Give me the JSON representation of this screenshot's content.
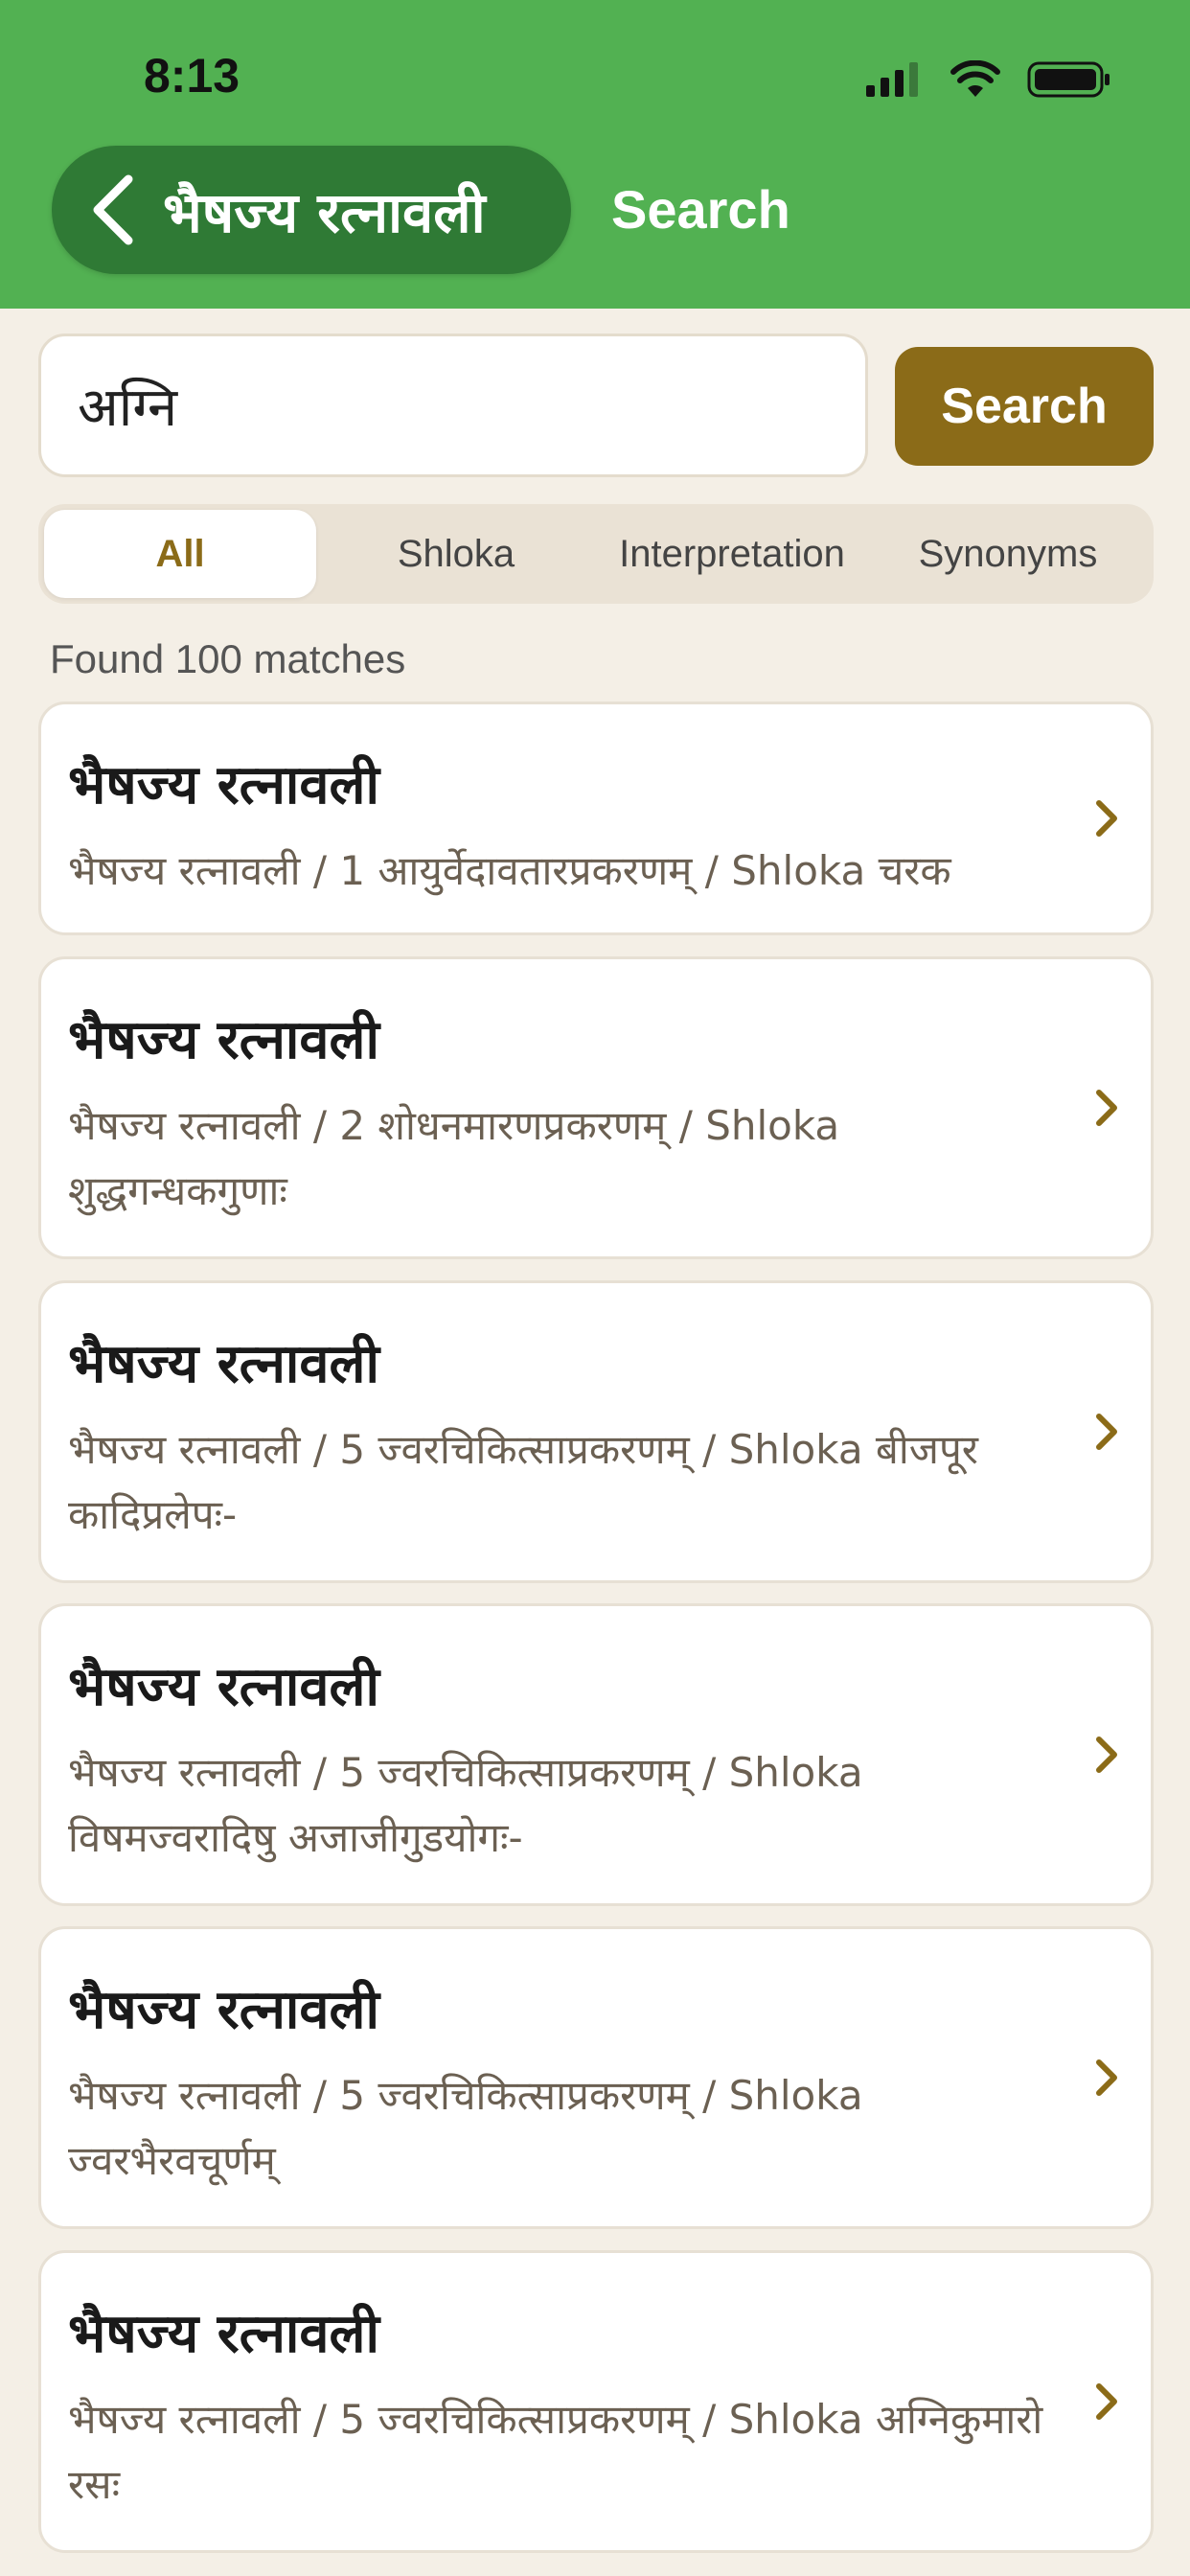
{
  "status_bar": {
    "time": "8:13"
  },
  "nav": {
    "back_label": "भैषज्य रत्नावली",
    "title": "Search"
  },
  "search": {
    "value": "अग्नि",
    "button_label": "Search"
  },
  "filters": {
    "tabs": [
      {
        "label": "All",
        "active": true
      },
      {
        "label": "Shloka",
        "active": false
      },
      {
        "label": "Interpretation",
        "active": false
      },
      {
        "label": "Synonyms",
        "active": false
      }
    ]
  },
  "results": {
    "count_text": "Found 100 matches",
    "items": [
      {
        "title": "भैषज्य रत्नावली",
        "subtitle": "भैषज्य रत्नावली / 1 आयुर्वेदावतारप्रकरणम् / Shloka चरक"
      },
      {
        "title": "भैषज्य रत्नावली",
        "subtitle": "भैषज्य रत्नावली / 2 शोधनमारणप्रकरणम् / Shloka शुद्धगन्धकगुणाः"
      },
      {
        "title": "भैषज्य रत्नावली",
        "subtitle": "भैषज्य रत्नावली / 5 ज्वरचिकित्साप्रकरणम् / Shloka बीजपूर कादिप्रलेपः-"
      },
      {
        "title": "भैषज्य रत्नावली",
        "subtitle": "भैषज्य रत्नावली / 5 ज्वरचिकित्साप्रकरणम् / Shloka विषमज्वरादिषु अजाजीगुडयोगः-"
      },
      {
        "title": "भैषज्य रत्नावली",
        "subtitle": "भैषज्य रत्नावली / 5 ज्वरचिकित्साप्रकरणम् / Shloka ज्वरभैरवचूर्णम्"
      },
      {
        "title": "भैषज्य रत्नावली",
        "subtitle": "भैषज्य रत्नावली / 5 ज्वरचिकित्साप्रकरणम् / Shloka अग्निकुमारो रसः"
      }
    ]
  },
  "colors": {
    "header": "#52b152",
    "accent": "#8b6b18",
    "background": "#f4efe6"
  }
}
